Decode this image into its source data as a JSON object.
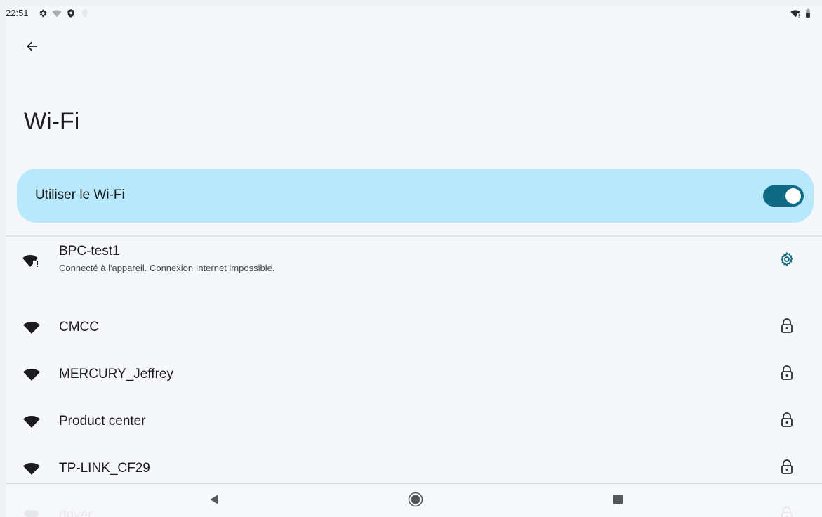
{
  "status_bar": {
    "time": "22:51",
    "left_icons": [
      "settings-gear-icon",
      "wifi-question-icon",
      "shield-icon",
      "location-dim-icon"
    ],
    "right_icons": [
      "wifi-alert-icon",
      "battery-icon"
    ]
  },
  "header": {
    "back_icon": "arrow-left-icon"
  },
  "page": {
    "title": "Wi-Fi"
  },
  "wifi_toggle": {
    "label": "Utiliser le Wi-Fi",
    "state": "on",
    "accent": "#0f6a84",
    "background": "#b8e8fb"
  },
  "networks": [
    {
      "name": "BPC-test1",
      "summary": "Connecté à l'appareil. Connexion Internet impossible.",
      "signal_icon": "wifi-alert-icon",
      "action_icon": "settings-gear-icon"
    },
    {
      "name": "CMCC",
      "signal_icon": "wifi-full-icon",
      "action_icon": "lock-icon"
    },
    {
      "name": "MERCURY_Jeffrey",
      "signal_icon": "wifi-full-icon",
      "action_icon": "lock-icon"
    },
    {
      "name": "Product center",
      "signal_icon": "wifi-full-icon",
      "action_icon": "lock-icon"
    },
    {
      "name": "TP-LINK_CF29",
      "signal_icon": "wifi-full-icon",
      "action_icon": "lock-icon"
    },
    {
      "name": "driver",
      "signal_icon": "wifi-full-icon",
      "action_icon": "lock-icon"
    }
  ],
  "nav_bar": {
    "back_icon": "triangle-back-icon",
    "home_icon": "circle-home-icon",
    "recents_icon": "square-recents-icon"
  }
}
